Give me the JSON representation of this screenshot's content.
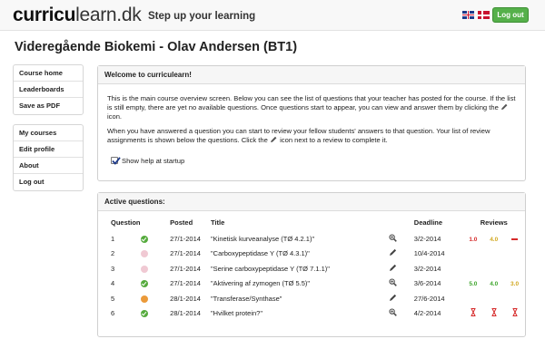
{
  "header": {
    "logo_bold": "curricu",
    "logo_rest": "learn.dk",
    "tagline": "Step up your learning",
    "logout_label": "Log out",
    "flags": [
      "flag-uk-icon",
      "flag-dk-icon"
    ]
  },
  "page_title": "Videregående Biokemi - Olav Andersen (BT1)",
  "sidebar": {
    "group1": [
      {
        "label": "Course home"
      },
      {
        "label": "Leaderboards"
      },
      {
        "label": "Save as PDF"
      }
    ],
    "group2": [
      {
        "label": "My courses"
      },
      {
        "label": "Edit profile"
      },
      {
        "label": "About"
      },
      {
        "label": "Log out"
      }
    ]
  },
  "welcome": {
    "title": "Welcome to curriculearn!",
    "p1_a": "This is the main course overview screen. Below you can see the list of questions that your teacher has posted for the course. If the list is still empty, there are yet no available questions. Once questions start to appear, you can view and answer them by clicking the",
    "p1_b": "icon.",
    "p2_a": "When you have answered a question you can start to review your fellow students' answers to that question. Your list of review assignments is shown below the questions. Click the",
    "p2_b": "icon next to a review to complete it.",
    "checkbox_label": "Show help at startup",
    "checkbox_checked": true
  },
  "questions": {
    "title": "Active questions:",
    "headers": {
      "question": "Question",
      "posted": "Posted",
      "title": "Title",
      "deadline": "Deadline",
      "reviews": "Reviews"
    },
    "rows": [
      {
        "num": "1",
        "status": "done",
        "posted": "27/1-2014",
        "title": "\"Kinetisk kurveanalyse (TØ 4.2.1)\"",
        "action": "magnifier-icon",
        "deadline": "3/2-2014",
        "reviews": [
          {
            "t": "text",
            "v": "1.0",
            "c": "red"
          },
          {
            "t": "text",
            "v": "4.0",
            "c": "yellow"
          },
          {
            "t": "dash",
            "v": "",
            "c": "red"
          }
        ]
      },
      {
        "num": "2",
        "status": "none",
        "posted": "27/1-2014",
        "title": "\"Carboxypeptidase Y (TØ 4.3.1)\"",
        "action": "pencil-icon",
        "deadline": "10/4-2014",
        "reviews": []
      },
      {
        "num": "3",
        "status": "none",
        "posted": "27/1-2014",
        "title": "\"Serine carboxypeptidase Y (TØ 7.1.1)\"",
        "action": "pencil-icon",
        "deadline": "3/2-2014",
        "reviews": []
      },
      {
        "num": "4",
        "status": "done",
        "posted": "27/1-2014",
        "title": "\"Aktivering af zymogen (TØ 5.5)\"",
        "action": "magnifier-icon",
        "deadline": "3/6-2014",
        "reviews": [
          {
            "t": "text",
            "v": "5.0",
            "c": "green"
          },
          {
            "t": "text",
            "v": "4.0",
            "c": "green"
          },
          {
            "t": "text",
            "v": "3.0",
            "c": "yellow"
          }
        ]
      },
      {
        "num": "5",
        "status": "part",
        "posted": "28/1-2014",
        "title": "\"Transferase/Synthase\"",
        "action": "pencil-icon",
        "deadline": "27/6-2014",
        "reviews": []
      },
      {
        "num": "6",
        "status": "done",
        "posted": "28/1-2014",
        "title": "\"Hvilket protein?\"",
        "action": "magnifier-icon",
        "deadline": "4/2-2014",
        "reviews": [
          {
            "t": "hourglass",
            "v": "",
            "c": "red"
          },
          {
            "t": "hourglass",
            "v": "",
            "c": "red"
          },
          {
            "t": "hourglass",
            "v": "",
            "c": "red"
          }
        ]
      }
    ]
  },
  "colors": {
    "logout_green": "#55b04a",
    "status_done": "#56ab3e",
    "status_none": "#f0c9d3",
    "status_partial": "#eb9a3a",
    "review_red": "#d62a2a",
    "review_green": "#3da52c",
    "review_yellow": "#d1a820"
  }
}
